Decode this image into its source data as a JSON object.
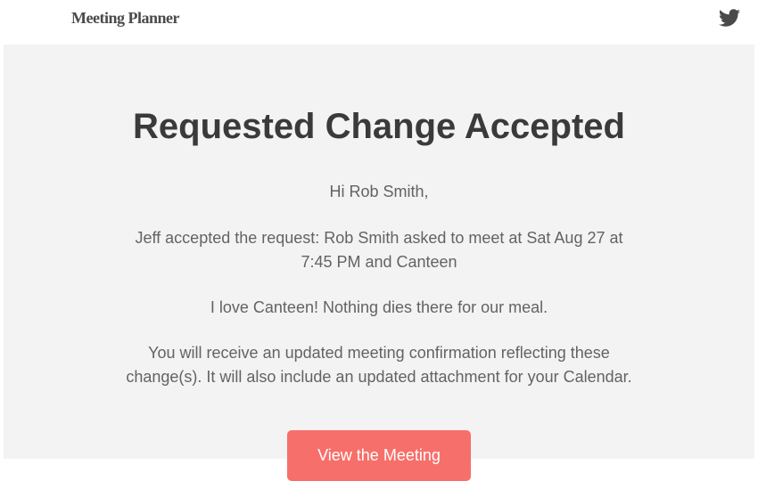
{
  "header": {
    "brand": "Meeting Planner"
  },
  "content": {
    "title": "Requested Change Accepted",
    "greeting": "Hi Rob Smith,",
    "para1": "Jeff accepted the request: Rob Smith asked to meet at Sat Aug 27 at 7:45 PM and Canteen",
    "para2": "I love Canteen! Nothing dies there for our meal.",
    "para3": "You will receive an updated meeting confirmation reflecting these change(s). It will also include an updated attachment for your Calendar.",
    "button_label": "View the Meeting"
  }
}
